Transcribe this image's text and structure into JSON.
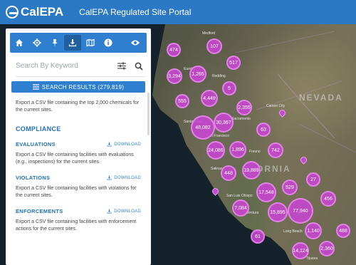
{
  "header": {
    "logo_text": "CalEPA",
    "title": "CalEPA Regulated Site Portal"
  },
  "toolbar": {
    "icons": [
      "home-icon",
      "locate-icon",
      "download-icon",
      "map-icon",
      "info-icon",
      "eye-icon"
    ],
    "active": "download-icon"
  },
  "search": {
    "placeholder": "Search By Keyword",
    "value": ""
  },
  "results_button": {
    "label": "SEARCH RESULTS (279,819)"
  },
  "intro_text": "Export a CSV file containing the top 2,000 chemicals for the current sites.",
  "compliance": {
    "title": "COMPLIANCE",
    "items": [
      {
        "title": "EVALUATIONS",
        "download": "DOWNLOAD",
        "desc": "Export a CSV file containing facilities with evaluations (e.g., inspections) for the current sites."
      },
      {
        "title": "VIOLATIONS",
        "download": "DOWNLOAD",
        "desc": "Export a CSV file containing facilities with violations for the current sites."
      },
      {
        "title": "ENFORCEMENTS",
        "download": "DOWNLOAD",
        "desc": "Export a CSV file containing facilities with enforcement actions for the current sites."
      }
    ]
  },
  "map": {
    "clusters": [
      "474",
      "107",
      "517",
      "3,294",
      "1,265",
      "5",
      "4,449",
      "555",
      "2,355",
      "48,082",
      "30,367",
      "63",
      "24,086",
      "1,896",
      "742",
      "448",
      "19,889",
      "529",
      "27",
      "17,548",
      "456",
      "7,084",
      "15,895",
      "77,940",
      "488",
      "61",
      "1,140",
      "2,360",
      "14,124"
    ],
    "places": [
      "Medford",
      "Eureka",
      "Redding",
      "Carson City",
      "Santa Rosa",
      "Sacramento",
      "San Francisco",
      "Salinas",
      "Fresno",
      "San Luis Obispo",
      "Ventura",
      "Long Beach",
      "Tijuana"
    ],
    "state_labels": [
      "NEVADA",
      "ORNIA"
    ],
    "cluster_color": "#c846d2"
  }
}
